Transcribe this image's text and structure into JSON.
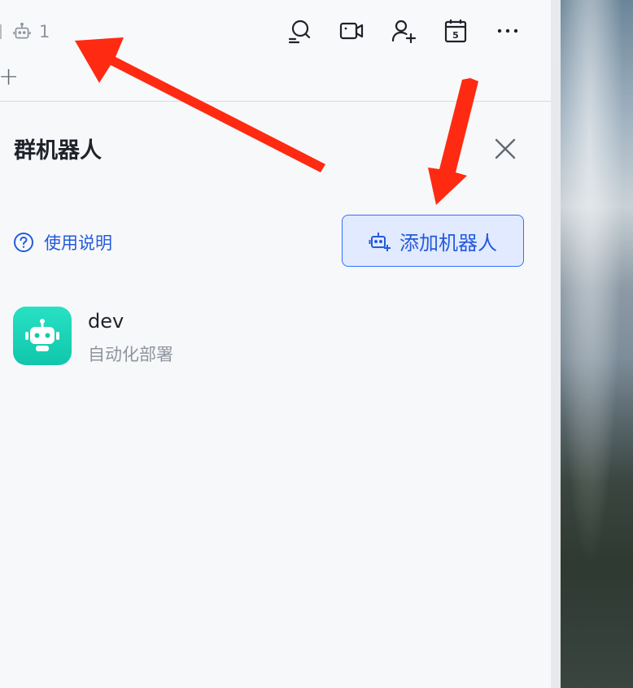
{
  "header": {
    "bot_count": "1",
    "toolbar_icons": [
      "search-icon",
      "video-icon",
      "add-member-icon",
      "calendar-icon",
      "more-icon"
    ],
    "calendar_day": "5"
  },
  "tab_add_label": "+",
  "drawer": {
    "title": "群机器人",
    "help_link": "使用说明",
    "add_button": "添加机器人"
  },
  "bots": [
    {
      "name": "dev",
      "description": "自动化部署",
      "avatar_color": "#1fd4b8"
    }
  ],
  "annotation": {
    "arrow_color": "#ff2a12"
  },
  "colors": {
    "accent": "#245bdb",
    "button_bg": "#e1eaff",
    "panel_bg": "#f7f8fa"
  }
}
